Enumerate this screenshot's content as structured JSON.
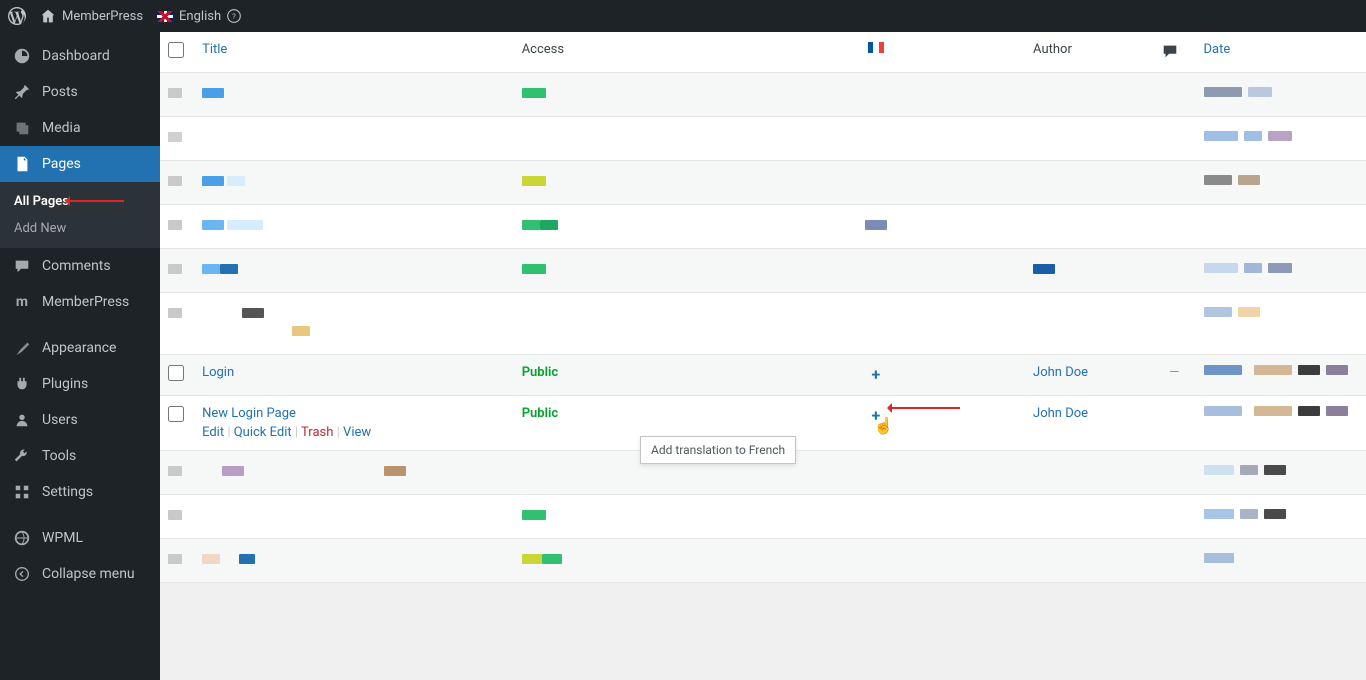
{
  "topbar": {
    "site_name": "MemberPress",
    "language": "English"
  },
  "sidebar": {
    "dashboard": "Dashboard",
    "posts": "Posts",
    "media": "Media",
    "pages": "Pages",
    "pages_sub": {
      "all": "All Pages",
      "add": "Add New"
    },
    "comments": "Comments",
    "memberpress": "MemberPress",
    "appearance": "Appearance",
    "plugins": "Plugins",
    "users": "Users",
    "tools": "Tools",
    "settings": "Settings",
    "wpml": "WPML",
    "collapse": "Collapse menu"
  },
  "table": {
    "headers": {
      "title": "Title",
      "access": "Access",
      "author": "Author",
      "date": "Date"
    },
    "login_row": {
      "title": "Login",
      "access": "Public",
      "author": "John Doe",
      "comments": "—"
    },
    "newlogin_row": {
      "title": "New Login Page",
      "access": "Public",
      "author": "John Doe",
      "actions": {
        "edit": "Edit",
        "quick": "Quick Edit",
        "trash": "Trash",
        "view": "View"
      }
    }
  },
  "tooltip": "Add translation to French"
}
